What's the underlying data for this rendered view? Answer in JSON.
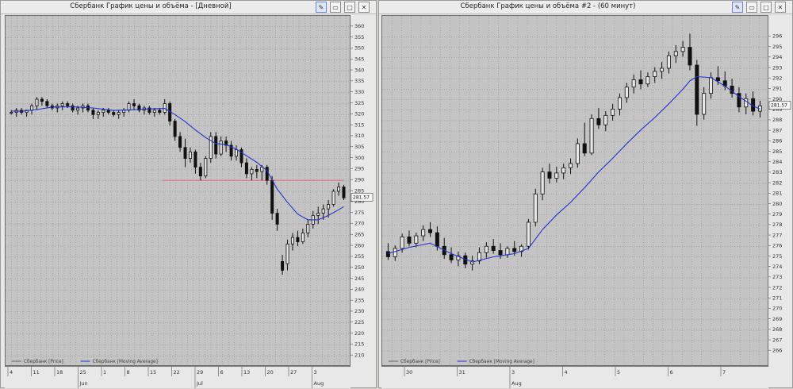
{
  "windows": [
    {
      "id": "daily",
      "title": "Сбербанк График цены и объёма - [Дневной]",
      "title_buttons": [
        "pin-icon",
        "minimize-icon",
        "maximize-icon",
        "close-icon"
      ]
    },
    {
      "id": "hourly",
      "title": "Сбербанк График цены и объёма #2 - (60 минут)",
      "title_buttons": [
        "pin-icon",
        "minimize-icon",
        "maximize-icon",
        "close-icon"
      ]
    }
  ],
  "colors": {
    "candle": "#111111",
    "moving_average": "#2233cc",
    "level_line": "#e07070",
    "grid": "#8a8a8a",
    "plot_bg": "#c4c4c4"
  },
  "chart_data": [
    {
      "type": "candlestick",
      "title": "Сбербанк График цены и объёма - [Дневной]",
      "ylim": [
        205,
        365
      ],
      "yticks": [
        210,
        215,
        220,
        225,
        230,
        235,
        240,
        245,
        250,
        255,
        260,
        265,
        270,
        275,
        280,
        285,
        290,
        295,
        300,
        305,
        310,
        315,
        320,
        325,
        330,
        335,
        340,
        345,
        350,
        355,
        360
      ],
      "x_day_labels": [
        "4",
        "11",
        "18",
        "25",
        "1",
        "8",
        "15",
        "22",
        "29",
        "6",
        "13",
        "20",
        "27",
        "3"
      ],
      "x_month_labels": [
        {
          "label": "Jun",
          "after_index": 3
        },
        {
          "label": "Jul",
          "after_index": 8
        },
        {
          "label": "Aug",
          "after_index": 13
        }
      ],
      "last_price_label": "281.57",
      "horizontal_level": 290,
      "legend": [
        {
          "name": "Сбербанк [Price]",
          "color": "#666666"
        },
        {
          "name": "Сбербанк [Moving Average]",
          "color": "#2233cc"
        }
      ],
      "ohlc": [
        [
          321,
          322,
          320,
          321
        ],
        [
          321,
          323,
          319,
          322
        ],
        [
          322,
          323,
          320,
          321
        ],
        [
          321,
          322,
          319,
          322
        ],
        [
          322,
          325,
          320,
          324
        ],
        [
          324,
          328,
          322,
          327
        ],
        [
          327,
          328,
          324,
          326
        ],
        [
          326,
          327,
          323,
          324
        ],
        [
          324,
          325,
          322,
          323
        ],
        [
          323,
          325,
          321,
          324
        ],
        [
          324,
          326,
          322,
          325
        ],
        [
          325,
          326,
          323,
          324
        ],
        [
          324,
          325,
          321,
          322
        ],
        [
          322,
          324,
          320,
          323
        ],
        [
          323,
          325,
          321,
          324
        ],
        [
          324,
          325,
          321,
          322
        ],
        [
          322,
          323,
          318,
          320
        ],
        [
          320,
          322,
          318,
          321
        ],
        [
          321,
          323,
          319,
          322
        ],
        [
          322,
          323,
          320,
          321
        ],
        [
          321,
          322,
          319,
          320
        ],
        [
          320,
          322,
          318,
          321
        ],
        [
          321,
          323,
          319,
          322
        ],
        [
          322,
          326,
          321,
          325
        ],
        [
          325,
          327,
          322,
          324
        ],
        [
          324,
          325,
          321,
          322
        ],
        [
          322,
          324,
          320,
          323
        ],
        [
          323,
          324,
          320,
          321
        ],
        [
          321,
          323,
          319,
          322
        ],
        [
          322,
          323,
          320,
          321
        ],
        [
          321,
          327,
          320,
          325
        ],
        [
          325,
          326,
          315,
          317
        ],
        [
          317,
          318,
          308,
          310
        ],
        [
          310,
          312,
          303,
          305
        ],
        [
          305,
          309,
          296,
          300
        ],
        [
          300,
          305,
          298,
          303
        ],
        [
          303,
          304,
          293,
          296
        ],
        [
          296,
          298,
          290,
          292
        ],
        [
          292,
          301,
          291,
          300
        ],
        [
          300,
          312,
          298,
          310
        ],
        [
          310,
          312,
          300,
          302
        ],
        [
          302,
          310,
          301,
          308
        ],
        [
          308,
          310,
          303,
          306
        ],
        [
          306,
          308,
          299,
          301
        ],
        [
          301,
          306,
          299,
          304
        ],
        [
          304,
          305,
          296,
          298
        ],
        [
          298,
          300,
          291,
          293
        ],
        [
          293,
          296,
          290,
          295
        ],
        [
          295,
          297,
          291,
          294
        ],
        [
          294,
          297,
          290,
          296
        ],
        [
          296,
          297,
          288,
          290
        ],
        [
          290,
          292,
          272,
          275
        ],
        [
          275,
          277,
          267,
          270
        ],
        [
          253,
          256,
          247,
          249
        ],
        [
          252,
          263,
          249,
          261
        ],
        [
          261,
          266,
          258,
          264
        ],
        [
          264,
          267,
          260,
          262
        ],
        [
          262,
          268,
          261,
          266
        ],
        [
          266,
          272,
          264,
          270
        ],
        [
          270,
          276,
          268,
          274
        ],
        [
          274,
          278,
          270,
          275
        ],
        [
          275,
          279,
          272,
          277
        ],
        [
          277,
          281,
          273,
          279
        ],
        [
          279,
          286,
          278,
          285
        ],
        [
          285,
          289,
          283,
          287
        ],
        [
          287,
          288,
          281,
          282
        ]
      ],
      "moving_average": [
        [
          0,
          321.6
        ],
        [
          2,
          321.5
        ],
        [
          5,
          322.3
        ],
        [
          8,
          323.4
        ],
        [
          12,
          323.6
        ],
        [
          16,
          323.0
        ],
        [
          20,
          321.9
        ],
        [
          24,
          322.2
        ],
        [
          28,
          322.7
        ],
        [
          30,
          322.8
        ],
        [
          32,
          320.0
        ],
        [
          34,
          316.8
        ],
        [
          36,
          313.0
        ],
        [
          38,
          309.5
        ],
        [
          40,
          306.8
        ],
        [
          42,
          306.3
        ],
        [
          44,
          304.2
        ],
        [
          46,
          301.2
        ],
        [
          48,
          298.2
        ],
        [
          50,
          294.4
        ],
        [
          52,
          286.0
        ],
        [
          54,
          280.0
        ],
        [
          56,
          274.6
        ],
        [
          58,
          272.0
        ],
        [
          60,
          272.0
        ],
        [
          62,
          274.0
        ],
        [
          64,
          276.6
        ],
        [
          65,
          278.0
        ]
      ]
    },
    {
      "type": "candlestick",
      "title": "Сбербанк График цены и объёма #2 - (60 минут)",
      "ylim": [
        264.5,
        298
      ],
      "yticks": [
        266,
        267,
        268,
        269,
        270,
        271,
        272,
        273,
        274,
        275,
        276,
        277,
        278,
        279,
        280,
        281,
        282,
        283,
        284,
        285,
        286,
        287,
        288,
        289,
        290,
        291,
        292,
        293,
        294,
        295,
        296
      ],
      "x_day_labels": [
        "30",
        "31",
        "3",
        "4",
        "5",
        "6",
        "7"
      ],
      "x_month_labels": [
        {
          "label": "Aug",
          "after_index": 2
        }
      ],
      "last_price_label": "281.57",
      "legend": [
        {
          "name": "Сбербанк [Price]",
          "color": "#666666"
        },
        {
          "name": "Сбербанк [Moving Average]",
          "color": "#2233cc"
        }
      ],
      "ohlc": [
        [
          275.5,
          276.3,
          274.7,
          275.0
        ],
        [
          275.0,
          276.1,
          274.6,
          275.8
        ],
        [
          275.8,
          277.2,
          275.4,
          276.9
        ],
        [
          276.9,
          277.5,
          276.0,
          276.3
        ],
        [
          276.3,
          277.3,
          275.9,
          277.0
        ],
        [
          277.0,
          278.0,
          276.5,
          277.6
        ],
        [
          277.6,
          278.3,
          276.9,
          277.3
        ],
        [
          277.3,
          277.9,
          275.6,
          276.0
        ],
        [
          276.0,
          276.8,
          274.8,
          275.2
        ],
        [
          275.2,
          275.9,
          274.4,
          274.7
        ],
        [
          274.7,
          275.5,
          274.1,
          275.1
        ],
        [
          275.1,
          275.4,
          273.9,
          274.3
        ],
        [
          274.3,
          275.1,
          273.7,
          274.6
        ],
        [
          274.6,
          275.9,
          274.3,
          275.4
        ],
        [
          275.4,
          276.4,
          274.9,
          276.0
        ],
        [
          276.0,
          276.7,
          275.3,
          275.6
        ],
        [
          275.6,
          276.3,
          274.8,
          275.2
        ],
        [
          275.2,
          276.0,
          274.9,
          275.8
        ],
        [
          275.8,
          276.5,
          275.1,
          275.5
        ],
        [
          275.5,
          276.2,
          275.0,
          276.0
        ],
        [
          276.0,
          278.6,
          275.7,
          278.3
        ],
        [
          278.3,
          281.5,
          277.9,
          281.0
        ],
        [
          281.0,
          283.5,
          280.4,
          283.1
        ],
        [
          283.1,
          283.9,
          282.0,
          282.5
        ],
        [
          282.5,
          283.6,
          282.1,
          283.0
        ],
        [
          283.0,
          283.9,
          282.4,
          283.5
        ],
        [
          283.5,
          284.4,
          282.9,
          283.9
        ],
        [
          283.9,
          286.3,
          283.5,
          285.8
        ],
        [
          285.8,
          287.8,
          284.6,
          284.9
        ],
        [
          284.9,
          288.6,
          284.7,
          288.2
        ],
        [
          288.2,
          289.2,
          287.2,
          287.6
        ],
        [
          287.6,
          288.9,
          287.0,
          288.5
        ],
        [
          288.5,
          289.6,
          288.0,
          289.1
        ],
        [
          289.1,
          290.6,
          288.5,
          290.2
        ],
        [
          290.2,
          291.6,
          289.7,
          291.2
        ],
        [
          291.2,
          292.4,
          290.6,
          291.9
        ],
        [
          291.9,
          292.8,
          291.0,
          291.5
        ],
        [
          291.5,
          292.6,
          291.2,
          292.2
        ],
        [
          292.2,
          293.1,
          291.6,
          292.7
        ],
        [
          292.7,
          293.6,
          292.0,
          293.0
        ],
        [
          293.0,
          294.6,
          292.5,
          294.2
        ],
        [
          294.2,
          295.2,
          293.5,
          294.6
        ],
        [
          294.6,
          295.6,
          294.1,
          295.0
        ],
        [
          295.0,
          296.3,
          292.8,
          293.3
        ],
        [
          293.3,
          293.8,
          287.5,
          288.6
        ],
        [
          288.6,
          291.2,
          288.1,
          290.6
        ],
        [
          290.6,
          292.6,
          290.1,
          292.1
        ],
        [
          292.1,
          293.2,
          291.4,
          291.8
        ],
        [
          291.8,
          292.7,
          290.9,
          291.3
        ],
        [
          291.3,
          292.0,
          290.2,
          290.6
        ],
        [
          290.6,
          291.2,
          288.8,
          289.3
        ],
        [
          289.3,
          290.6,
          288.6,
          290.1
        ],
        [
          290.1,
          290.8,
          288.5,
          288.9
        ],
        [
          288.9,
          289.9,
          288.3,
          289.4
        ]
      ],
      "moving_average": [
        [
          0,
          275.3
        ],
        [
          3,
          275.9
        ],
        [
          6,
          276.3
        ],
        [
          9,
          275.3
        ],
        [
          12,
          274.5
        ],
        [
          15,
          275.0
        ],
        [
          18,
          275.3
        ],
        [
          20,
          275.8
        ],
        [
          22,
          277.6
        ],
        [
          24,
          279.0
        ],
        [
          26,
          280.2
        ],
        [
          28,
          281.6
        ],
        [
          30,
          283.1
        ],
        [
          32,
          284.4
        ],
        [
          34,
          285.8
        ],
        [
          36,
          287.1
        ],
        [
          38,
          288.3
        ],
        [
          40,
          289.6
        ],
        [
          42,
          291.0
        ],
        [
          43,
          291.8
        ],
        [
          44,
          292.2
        ],
        [
          46,
          292.1
        ],
        [
          48,
          291.3
        ],
        [
          50,
          290.3
        ],
        [
          52,
          289.4
        ],
        [
          53,
          289.1
        ]
      ]
    }
  ]
}
